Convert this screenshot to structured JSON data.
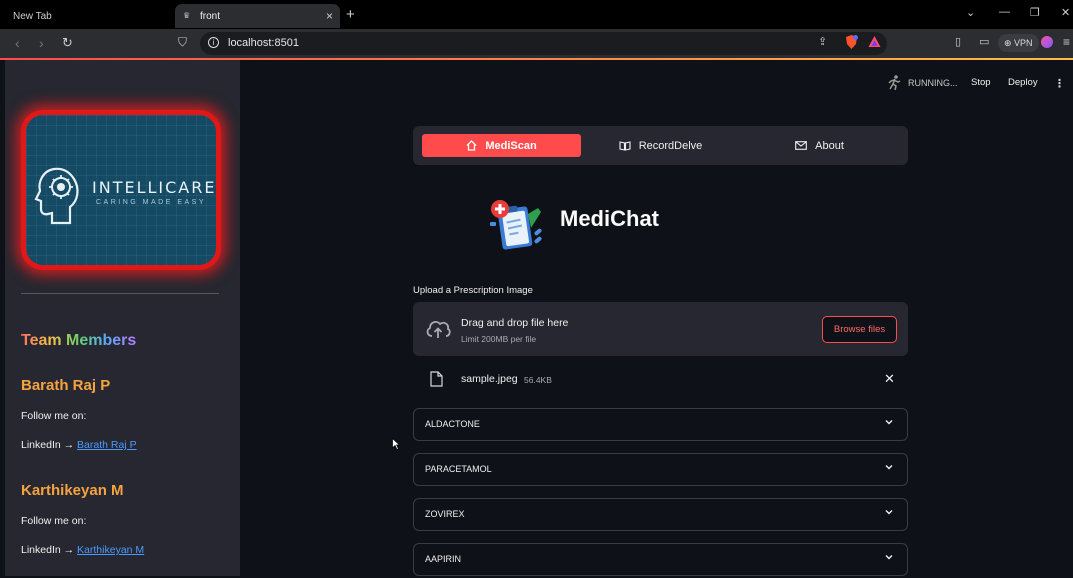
{
  "browser": {
    "tabs": [
      {
        "label": "New Tab"
      },
      {
        "label": "front"
      }
    ],
    "url": "localhost:8501",
    "vpn_label": "VPN"
  },
  "sidebar": {
    "logo": {
      "title": "INTELLICARE",
      "tagline": "CARING MADE EASY"
    },
    "team_title": "Team Members",
    "members": [
      {
        "name": "Barath Raj P",
        "follow": "Follow me on:",
        "linkedin_prefix": "LinkedIn →",
        "linkedin_link": "Barath Raj P"
      },
      {
        "name": "Karthikeyan M",
        "follow": "Follow me on:",
        "linkedin_prefix": "LinkedIn →",
        "linkedin_link": "Karthikeyan M"
      }
    ]
  },
  "header": {
    "status": "RUNNING...",
    "stop_label": "Stop",
    "deploy_label": "Deploy"
  },
  "menu": {
    "items": [
      {
        "label": "MediScan",
        "icon": "home-icon",
        "active": true
      },
      {
        "label": "RecordDelve",
        "icon": "book-icon",
        "active": false
      },
      {
        "label": "About",
        "icon": "envelope-icon",
        "active": false
      }
    ]
  },
  "main": {
    "title": "MediChat",
    "upload": {
      "label": "Upload a Prescription Image",
      "drop_text": "Drag and drop file here",
      "limit_text": "Limit 200MB per file",
      "browse_label": "Browse files"
    },
    "file": {
      "name": "sample.jpeg",
      "size": "56.4KB"
    },
    "expanders": [
      {
        "label": "ALDACTONE"
      },
      {
        "label": "PARACETAMOL"
      },
      {
        "label": "ZOVIREX"
      },
      {
        "label": "AAPIRIN"
      }
    ]
  },
  "colors": {
    "accent": "#ff4b4b",
    "background": "#0e1117",
    "sidebar": "#262730",
    "member_name": "#f5a340",
    "link": "#4a9bff"
  }
}
